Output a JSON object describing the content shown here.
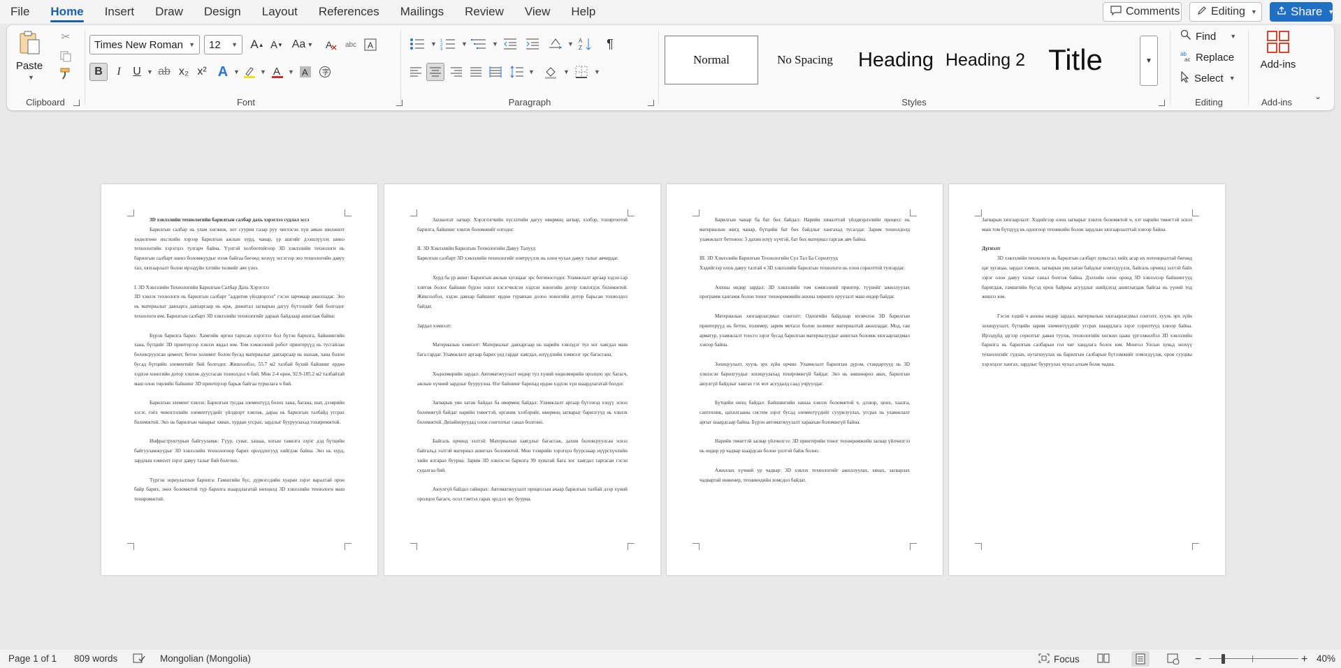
{
  "menu": {
    "tabs": [
      "File",
      "Home",
      "Insert",
      "Draw",
      "Design",
      "Layout",
      "References",
      "Mailings",
      "Review",
      "View",
      "Help"
    ],
    "active": "Home",
    "comments_label": "Comments",
    "editing_label": "Editing",
    "share_label": "Share"
  },
  "ribbon": {
    "clipboard": {
      "paste_label": "Paste",
      "group_label": "Clipboard"
    },
    "font": {
      "font_name": "Times New Roman",
      "font_size": "12",
      "case_label": "Aa",
      "group_label": "Font",
      "bold": "B",
      "italic": "I",
      "underline": "U",
      "strike": "ab",
      "sub": "x₂",
      "sup": "x²"
    },
    "paragraph": {
      "group_label": "Paragraph"
    },
    "styles": {
      "group_label": "Styles",
      "items": [
        "Normal",
        "No Spacing",
        "Heading",
        "Heading 2",
        "Title"
      ]
    },
    "editing": {
      "find_label": "Find",
      "replace_label": "Replace",
      "select_label": "Select",
      "group_label": "Editing"
    },
    "addins": {
      "label": "Add-ins",
      "group_label": "Add-ins"
    }
  },
  "document": {
    "page1": [
      {
        "cls": "title",
        "text": "3D хэвлэлийн технологийн барилгын салбар дахь хэрэглээ судлал эссэ"
      },
      {
        "cls": "ind",
        "text": "Барилгын салбар нь улам хөгжиж, хот суурин газар руу чиглэсэн хүн амын шилжилт хөдөлгөөн ихсэхийн хэрээр барилгын ажлын хурд, чанар, үр ашгийг дээшлүүлэх шинэ технологийн хэрэгцээ тулгарч байна. Үүнтэй холбоотойгоор 3D хэвлэлийн технологи нь барилгын салбарт шинэ боломжуудыг нээж байгаа бөгөөд энэхүү эссэгээр энэ технологийн давуу тал, хязгаарлалт болон ирээдүйн хэтийн төлвийг авч үзнэ."
      },
      {
        "cls": "gap",
        "text": "I. 3D Хэвлэлийн Технологийн Барилгын Салбар Дахь Хэрэглээ"
      },
      {
        "cls": "",
        "text": "3D хэвлэх технологи нь барилгын салбарт \"аддитив үйлдвэрлэл\" гэсэн зарчмаар ажилладаг. Энэ нь материалыг давхарга давхаргаар нь өрж, дижитал загварын дагуу бүтээцийг бий болгодог технологи юм. Барилгын салбарт 3D хэвлэлийн технологийг дараах байдлаар ашиглаж байна:"
      },
      {
        "cls": "ind gap",
        "text": "Бүрэн барилга барих: Хамгийн өргөн тархсан хэрэглээ бол бүтэн барилга, байшингийн хана, бүтцийг 3D принтерээр хэвлэх явдал юм. Том хэмжээний робот принтерүүд нь тусгайлан боловсруулсан цемент, бетон холимог болон бусад материалыг давхаргаар нь шахаж, хана болон бусад бүтцийн элементийг бий болгодог. Жишээлбэл, 55.7 м2 талбай бүхий байшинг ердөө хэдхэн хоногийн дотор хэвлэж дуусгасан тохиолдол ч бий. Мөн 2-4 өрөө, 92.9-185.2 м2 талбайтай маш олон төрлийн байшинг 3D принтерээр барьж байгаа туршлага ч бий."
      },
      {
        "cls": "ind gap",
        "text": "Барилгын элемент хэвлэх: Барилгын тусдаа элементүүд болох хана, багана, шат, дээврийн хэсэг, гоёл чимэглэлийн элементүүдийг үйлдвэрт хэвлэж, дараа нь барилгын талбайд угсрах боломжтой. Энэ нь барилгын чанарыг хянах, хурдан угсрах, зардлыг бууруулахад тохиромжтой."
      },
      {
        "cls": "ind gap",
        "text": "Инфраструктурын байгууламж: Гүүр, суваг, хашаа, хотын тавилга зэрэг дэд бүтцийн байгууламжуудыг 3D хэвлэлийн технологиор барих оролдлогууд хийгдэж байна. Энэ нь хурд, зардлын хэмнэлт зэрэг давуу талыг бий болгоно."
      },
      {
        "cls": "ind gap",
        "text": "Түргэн зориулалтын барилга: Гамшгийн бүс, дүрвэгсдийн хуаран зэрэг яаралтай орон байр барих, зөөх боломжтой түр барилга шаардлагатай нөхцөлд 3D хэвлэлийн технологи маш тохиромжтой."
      }
    ],
    "page2": [
      {
        "cls": "ind",
        "text": "Захиалгат загвар: Хэрэглэгчийн хүсэлтийн дагуу өвөрмөц загвар, хэлбэр, тохиргоотой барилга, байшинг хэвлэх боломжийг олгодог."
      },
      {
        "cls": "gap",
        "text": "II. 3D Хэвлэлийн Барилгын Технологийн Давуу Талууд"
      },
      {
        "cls": "",
        "text": "Барилгын салбарт 3D хэвлэлийн технологийг нэвтрүүлэх нь олон чухал давуу талыг авчирдаг."
      },
      {
        "cls": "ind gap",
        "text": "Хурд ба үр ашиг: Барилгын ажлын хугацааг эрс богиносгодог. Уламжлалт аргаар хэдэн сар хэвтэж болох байшин бүрэн эсвэл хэсэгчилсэн хэдхэн хоногийн дотор хэвлэгдэх боломжтой. Жишээлбэл, хэдэн давхар байшинг ердөө гуравхан долоо хоногийн дотор барьсан тохиолдол байдаг."
      },
      {
        "cls": "gap",
        "text": "Зардал хэмнэлт:"
      },
      {
        "cls": "ind gap",
        "text": "Материалын хэмнэлт: Материалыг давхаргаар нь нарийн хэвлэдэг тул хог хаягдал маш бага гардаг. Уламжлалт аргаар барих үед гардаг хаягдал, илүүдлийн хэмжээг эрс багасгана."
      },
      {
        "cls": "ind gap",
        "text": "Хөдөлмөрийн зардал: Автоматжуулалт өндөр тул хүний хөдөлмөрийн оролцоо эрс багасч, ажлын хүчний зардлыг бууруулна. Нэг байшинг барихад ердөө хэдхэн хүн шаардлагатай болдог."
      },
      {
        "cls": "ind gap",
        "text": "Загварын уян хатан байдал ба өвөрмөц байдал: Уламжлалт аргаар бүтээхэд хэцүү эсвэл боломжгүй байдаг нарийн төвөгтэй, органик хэлбэрийг, өвөрмөц загварыг барилгууд нь хэвлэх боломжтой. Дизайнеруудад олон сонголтыг санал болгоно."
      },
      {
        "cls": "ind gap",
        "text": "Байгаль орчинд ээлтэй: Материалын хаягдлыг багасгаж, дахин боловсруулсан эсвэл байгальд ээлтэй материал ашиглах боломжтой. Мөн тээврийн хэрэгцээ буурснаар нүүрсхүчлийн хийн ялгарал буурна. Зарим 3D хэвлэсэн барилга 99 хувьтай бага хог хаягдал гаргасан гэсэн судалгаа бий."
      },
      {
        "cls": "ind gap",
        "text": "Аюулгүй байдал сайжрах: Автоматжуулалт процессын ачаар барилгын талбай дээр хүний оролцоо багасч, осол гэмтэл гарах эрсдэл эрс буурна."
      }
    ],
    "page3": [
      {
        "cls": "ind",
        "text": "Барилгын чанар ба бат бөх байдал: Нарийн хяналттай үйлдвэрлэлийн процесс нь материалын жигд чанар, бүтцийн бат бөх байдлыг хангахад тусалдаг. Зарим тохиолдолд уламжлалт бетоноос 3 дахин илүү хүчтэй, бат бөх материал гаргаж авч байна."
      },
      {
        "cls": "gap",
        "text": "III. 3D Хэвлэлийн Барилгын Технологийн Сул Тал Ба Сорилтууд"
      },
      {
        "cls": "",
        "text": "Хэдийгээр олон давуу талтай ч 3D хэвлэлийн барилгын технологи нь олон сорилттой тулгардаг."
      },
      {
        "cls": "ind gap",
        "text": "Анхны өндөр зардал: 3D хэвлэлийн том хэмжээний принтер, түүнийг ажиллуулах программ хангамж болон тоног төхөөрөмжийн анхны хөрөнгө оруулалт маш өндөр байдаг."
      },
      {
        "cls": "ind gap",
        "text": "Материалын хязгаарлагдмал сонголт: Одоогийн байдлаар ихэвчлэн 3D барилгын принтерүүд нь бетон, полимер, зарим металл болон холимог материалтай ажилладаг. Мод, ган арматур, уламжлалт тоосго зэрэг бусад барилгын материалуудыг ашиглах боломж хязгаарлагдмал хэвээр байна."
      },
      {
        "cls": "ind gap",
        "text": "Зохицуулалт, хууль эрх зүйн орчин: Уламжлалт барилгын дүрэм, стандартууд нь 3D хэвлэсэн барилгуудыг зохицуулахад тохиромжгүй байдаг. Энэ нь зөвшөөрөл авах, барилгын аюулгүй байдлыг хангах гэх мэт асуудалд саад учруулдаг."
      },
      {
        "cls": "ind gap",
        "text": "Бүтцийн нөхц байдал: Байшингийн хашаа хэвлэх боломжтой ч, дээвэр, цонх, хаалга, сантехник, цахилгааны систем зэрэг бусад элементүүдийг суурилуулах, угсрах нь уламжлалт аргыг шаардсаар байна. Бүрэн автоматжуулалт хараахан боломжгүй байна."
      },
      {
        "cls": "ind gap",
        "text": "Нарийн төвөгтэй засвар үйлчилгээ: 3D принтерийн тоног төхөөрөмжийн засвар үйлчилгээ нь өндөр ур чадвар шаардсан болон үнэтэй байж болно."
      },
      {
        "cls": "ind gap",
        "text": "Ажиллах хүчний ур чадвар: 3D хэвлэх технологийг ажиллуулах, хянах, засварлах чадвартай инженер, техникчдийн хомсдол байдаг."
      }
    ],
    "page4": [
      {
        "cls": "",
        "text": "Загварын хязгаарлалт: Хэдийгээр олон загварыг хэвлэх боломжтой ч, хэт нарийн төвөгтэй эсвэл маш том бүтцүүд нь одоогоор техникийн болон зардлын хязгаарлалттай хэвээр байна."
      },
      {
        "cls": "gap title-noind",
        "text": "Дүгнэлт"
      },
      {
        "cls": "ind",
        "text": "3D хэвлэлийн технологи нь барилгын салбарт хувьсгал хийх асар их потенциалтай бөгөөд цаг хугацаа, зардал хэмнэх, загварын уян хатан байдлыг нэмэгдүүлэх, байгаль орчинд ээлтэй байх зэрэг олон давуу талыг санал болгож байна. Дэлхийн олон оронд 3D хэвлэлээр байшингууд баригдаж, гамшгийн бүсэд орон байрны асуудлыг шийдэхэд ашиглагдаж байгаа нь үүний тод жишээ юм."
      },
      {
        "cls": "ind gap",
        "text": "Гэсэн хэдий ч анхны өндөр зардал, материалын хязгаарлагдмал сонголт, хууль эрх зүйн зохицуулалт, бүтцийн зарим элементүүдийг угсрах шаардлага зэрэг сорилтууд хэвээр байна. Ирээдүйд эдгээр сорилтыг даван туулж, технологийн хөгжил цааш үргэлжилбэл 3D хэвлэлийн барилга нь барилгын салбарын гол чиг хандлага болох юм. Монгол Улсын хувьд энэхүү технологийг судлах, нутагшуулах нь барилгын салбарын бүтээмжийг нэмэгдүүлж, орон сууцны хэрэгцээг хангах, зардлыг бууруулах чухал алхам болж чадна."
      }
    ]
  },
  "status": {
    "page": "Page 1 of 1",
    "words": "809 words",
    "language": "Mongolian (Mongolia)",
    "focus": "Focus",
    "zoom": "40%"
  },
  "colors": {
    "accent": "#1a5fb4",
    "share": "#1f6fc5",
    "addins": "#d9442c"
  }
}
